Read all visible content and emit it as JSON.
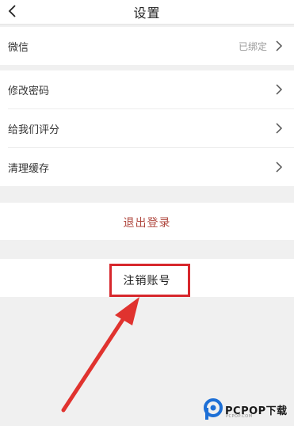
{
  "nav": {
    "title": "设置"
  },
  "settings": {
    "wechat": {
      "label": "微信",
      "status": "已绑定"
    },
    "change_password": {
      "label": "修改密码"
    },
    "rate_us": {
      "label": "给我们评分"
    },
    "clear_cache": {
      "label": "清理缓存"
    }
  },
  "actions": {
    "logout": "退出登录",
    "cancel_account": "注销账号"
  },
  "annotation": {
    "highlight_color": "#d7272c"
  },
  "watermark": {
    "brand": "PCPOP下载",
    "tagline": "PCPOP.COM"
  }
}
